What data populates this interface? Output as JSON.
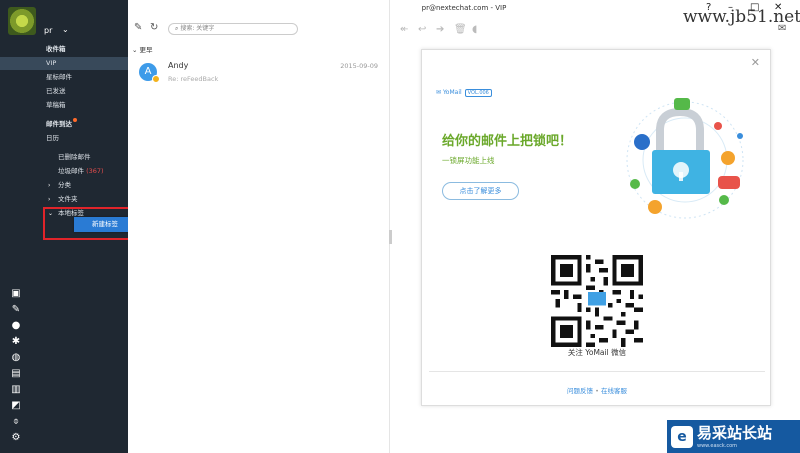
{
  "window": {
    "title": "pr@nextechat.com - VIP",
    "btn_help": "?",
    "btn_min": "–",
    "btn_max": "□",
    "btn_close": "✕"
  },
  "account": {
    "name": "pr",
    "chevron": "⌄"
  },
  "sidebar": {
    "inbox": "收件箱",
    "vip": "VIP",
    "starred": "星标邮件",
    "sent": "已发送",
    "drafts": "草稿箱",
    "reminders": "邮件到达",
    "calendar": "日历",
    "deleted": "已删除邮件",
    "spam": "垃圾邮件",
    "spam_count": "(367)",
    "categories": "分类",
    "folders": "文件夹",
    "local_tags": "本地标签",
    "context_menu_item": "新建标签"
  },
  "list": {
    "search_placeholder": "搜索: 关键字",
    "group": "更早",
    "mail": {
      "avatar_letter": "A",
      "sender": "Andy",
      "date": "2015-09-09",
      "subject": "Re: reFeedBack"
    }
  },
  "card": {
    "logo": "YoMail",
    "version": "VOL.006",
    "headline": "给你的邮件上把锁吧！",
    "subline": "一锁屏功能上线",
    "learn_more": "点击了解更多",
    "qr_caption": "关注 YoMail 微信",
    "link_feedback": "问题反馈",
    "link_sep": "•",
    "link_support": "在线客服"
  },
  "watermark": {
    "top": "www.jb51.net",
    "bottom_text": "易采站长站",
    "bottom_url": "www.easck.com"
  },
  "colors": {
    "sidebar_bg": "#1f2832",
    "accent_blue": "#2a7bd4",
    "highlight_red": "#e0242a",
    "headline_green": "#6aa82a"
  }
}
